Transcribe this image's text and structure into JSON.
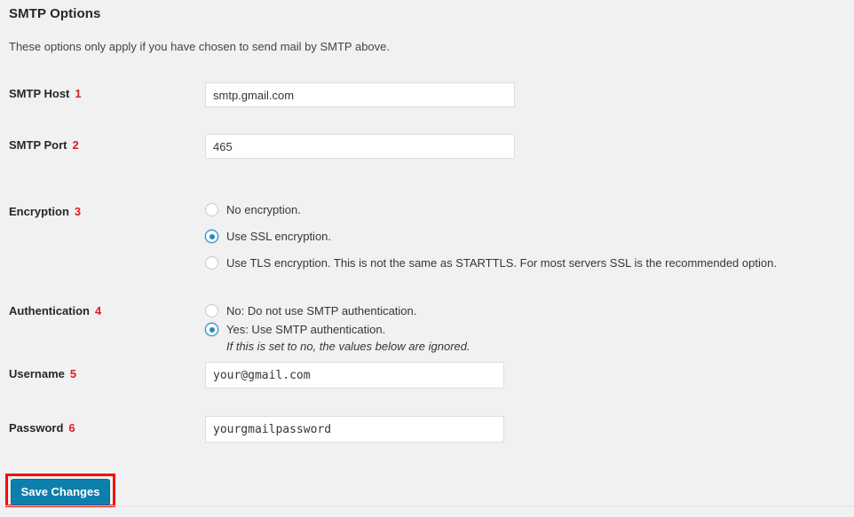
{
  "section": {
    "title": "SMTP Options",
    "description": "These options only apply if you have chosen to send mail by SMTP above."
  },
  "fields": {
    "smtp_host": {
      "label": "SMTP Host",
      "marker": "1",
      "value": "smtp.gmail.com"
    },
    "smtp_port": {
      "label": "SMTP Port",
      "marker": "2",
      "value": "465"
    },
    "encryption": {
      "label": "Encryption",
      "marker": "3",
      "options": [
        {
          "text": "No encryption.",
          "selected": false
        },
        {
          "text": "Use SSL encryption.",
          "selected": true
        },
        {
          "text": "Use TLS encryption. This is not the same as STARTTLS. For most servers SSL is the recommended option.",
          "selected": false
        }
      ]
    },
    "authentication": {
      "label": "Authentication",
      "marker": "4",
      "options": [
        {
          "text": "No: Do not use SMTP authentication.",
          "selected": false
        },
        {
          "text": "Yes: Use SMTP authentication.",
          "selected": true
        }
      ],
      "note": "If this is set to no, the values below are ignored."
    },
    "username": {
      "label": "Username",
      "marker": "5",
      "value": "your@gmail.com"
    },
    "password": {
      "label": "Password",
      "marker": "6",
      "value": "yourgmailpassword"
    }
  },
  "submit": {
    "label": "Save Changes"
  },
  "colors": {
    "accent": "#0d7fad",
    "marker": "#e01b24",
    "highlight": "#ff0000",
    "background": "#f1f1f1"
  }
}
